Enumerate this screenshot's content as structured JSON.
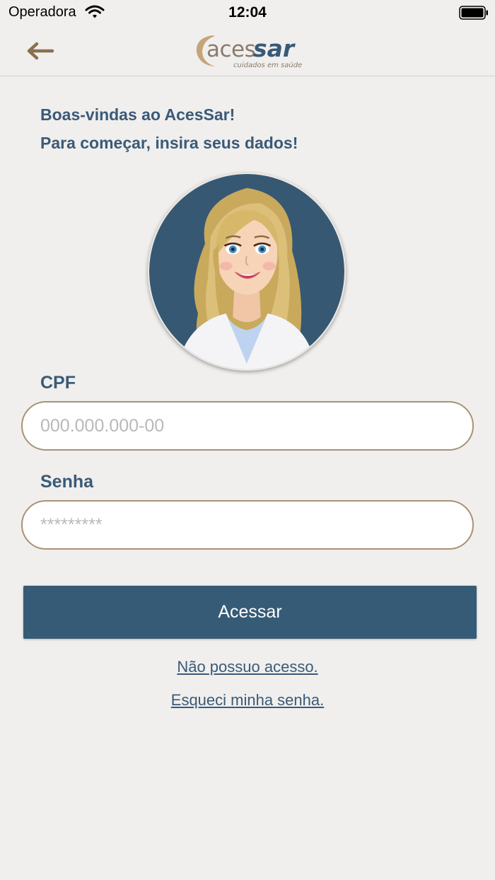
{
  "status_bar": {
    "carrier": "Operadora",
    "time": "12:04"
  },
  "header": {
    "back_icon": "arrow-left-icon",
    "logo": {
      "brand": "acessar",
      "tagline": "cuidados em saúde"
    }
  },
  "welcome": {
    "line1": "Boas-vindas ao AcesSar!",
    "line2": "Para começar, insira seus dados!"
  },
  "form": {
    "cpf_label": "CPF",
    "cpf_placeholder": "000.000.000-00",
    "senha_label": "Senha",
    "senha_placeholder": "*********",
    "submit_label": "Acessar"
  },
  "links": {
    "no_access": "Não possuo acesso.",
    "forgot_password": "Esqueci minha senha."
  },
  "colors": {
    "background": "#f0efed",
    "primary": "#365b76",
    "text_primary": "#3a5a78",
    "input_border": "#a89274",
    "logo_gold": "#c4a57a"
  }
}
